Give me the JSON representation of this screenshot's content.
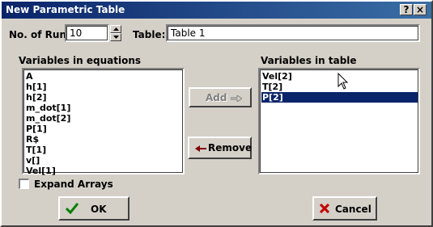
{
  "window": {
    "title": "New Parametric Table"
  },
  "titlebar": {
    "help_label": "?",
    "close_label": "×"
  },
  "runs": {
    "label": "No. of Runs",
    "value": "10"
  },
  "table": {
    "label": "Table:",
    "value": "Table 1"
  },
  "left_list": {
    "label": "Variables in equations",
    "items": [
      "A",
      "h[1]",
      "h[2]",
      "m_dot[1]",
      "m_dot[2]",
      "P[1]",
      "R$",
      "T[1]",
      "v[]",
      "Vel[1]"
    ]
  },
  "right_list": {
    "label": "Variables in table",
    "items": [
      "Vel[2]",
      "T[2]",
      "P[2]"
    ],
    "selected": "P[2]"
  },
  "add_button": {
    "label": "Add",
    "enabled": false
  },
  "remove_button": {
    "label": "Remove"
  },
  "expand_arrays": {
    "label": "Expand Arrays",
    "checked": false
  },
  "ok_button": {
    "label": "OK"
  },
  "cancel_button": {
    "label": "Cancel"
  },
  "colors": {
    "title_start": "#0a246a",
    "title_end": "#3a6ea5",
    "selection": "#0a246a",
    "face": "#d4d0c8"
  }
}
